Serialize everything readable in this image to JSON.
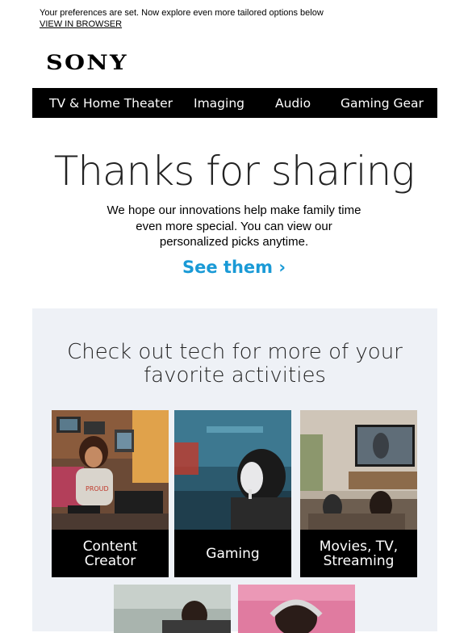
{
  "preheader": {
    "text": "Your preferences are set. Now explore even more tailored options below",
    "link": "VIEW IN BROWSER"
  },
  "brand": {
    "logo": "SONY"
  },
  "nav": {
    "items": [
      {
        "label": "TV & Home Theater"
      },
      {
        "label": "Imaging"
      },
      {
        "label": "Audio"
      },
      {
        "label": "Gaming Gear"
      }
    ]
  },
  "hero": {
    "headline": "Thanks for sharing",
    "body": "We hope our innovations help make family time even more special. You can view our personalized picks anytime.",
    "cta": "See them ›"
  },
  "activities": {
    "title": "Check out tech for more of your favorite activities",
    "tiles": [
      {
        "label": "Content\nCreator"
      },
      {
        "label": "Gaming"
      },
      {
        "label": "Movies, TV,\nStreaming"
      }
    ]
  },
  "colors": {
    "accent": "#1a9ad6",
    "nav_bg": "#000000",
    "panel_bg": "#eef1f6"
  }
}
